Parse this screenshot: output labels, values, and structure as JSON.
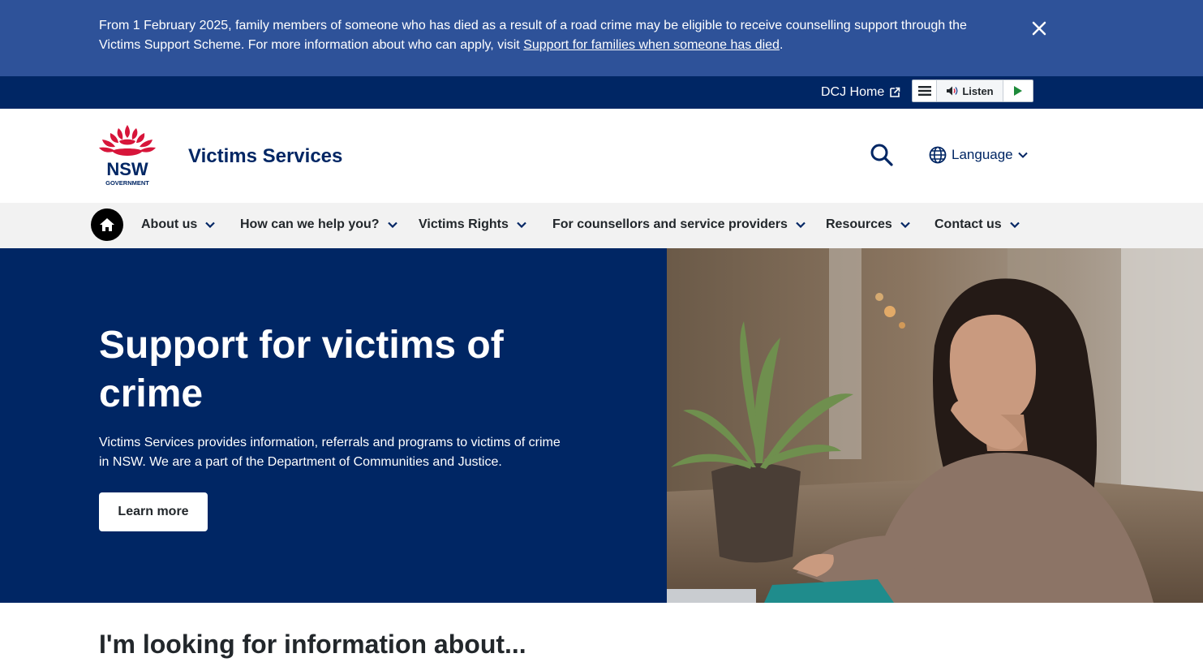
{
  "alert": {
    "text": "From 1 February 2025, family members of someone who has died as a result of a road crime may be eligible to receive counselling support through the Victims Support Scheme. For more information about who can apply, visit ",
    "link_text": "Support for families when someone has died",
    "text_end": "."
  },
  "utility": {
    "dcj_home": "DCJ Home",
    "listen_label": "Listen"
  },
  "header": {
    "logo_nsw": "NSW",
    "logo_government": "GOVERNMENT",
    "site_name": "Victims Services",
    "language_label": "Language"
  },
  "nav": {
    "items": [
      {
        "label": "About us"
      },
      {
        "label": "How can we help you?"
      },
      {
        "label": "Victims Rights"
      },
      {
        "label": "For counsellors and service providers"
      },
      {
        "label": "Resources"
      },
      {
        "label": "Contact us"
      }
    ]
  },
  "hero": {
    "title": "Support for victims of crime",
    "description": "Victims Services provides information, referrals and programs to victims of crime in NSW. We are a part of the Department of Communities and Justice.",
    "cta": "Learn more"
  },
  "section": {
    "heading": "I'm looking for information about..."
  },
  "colors": {
    "alert_bg": "#2e5299",
    "utility_bg": "#002664",
    "brand_navy": "#002664",
    "nav_bg": "#f2f2f2",
    "waratah_red": "#d7153a"
  }
}
